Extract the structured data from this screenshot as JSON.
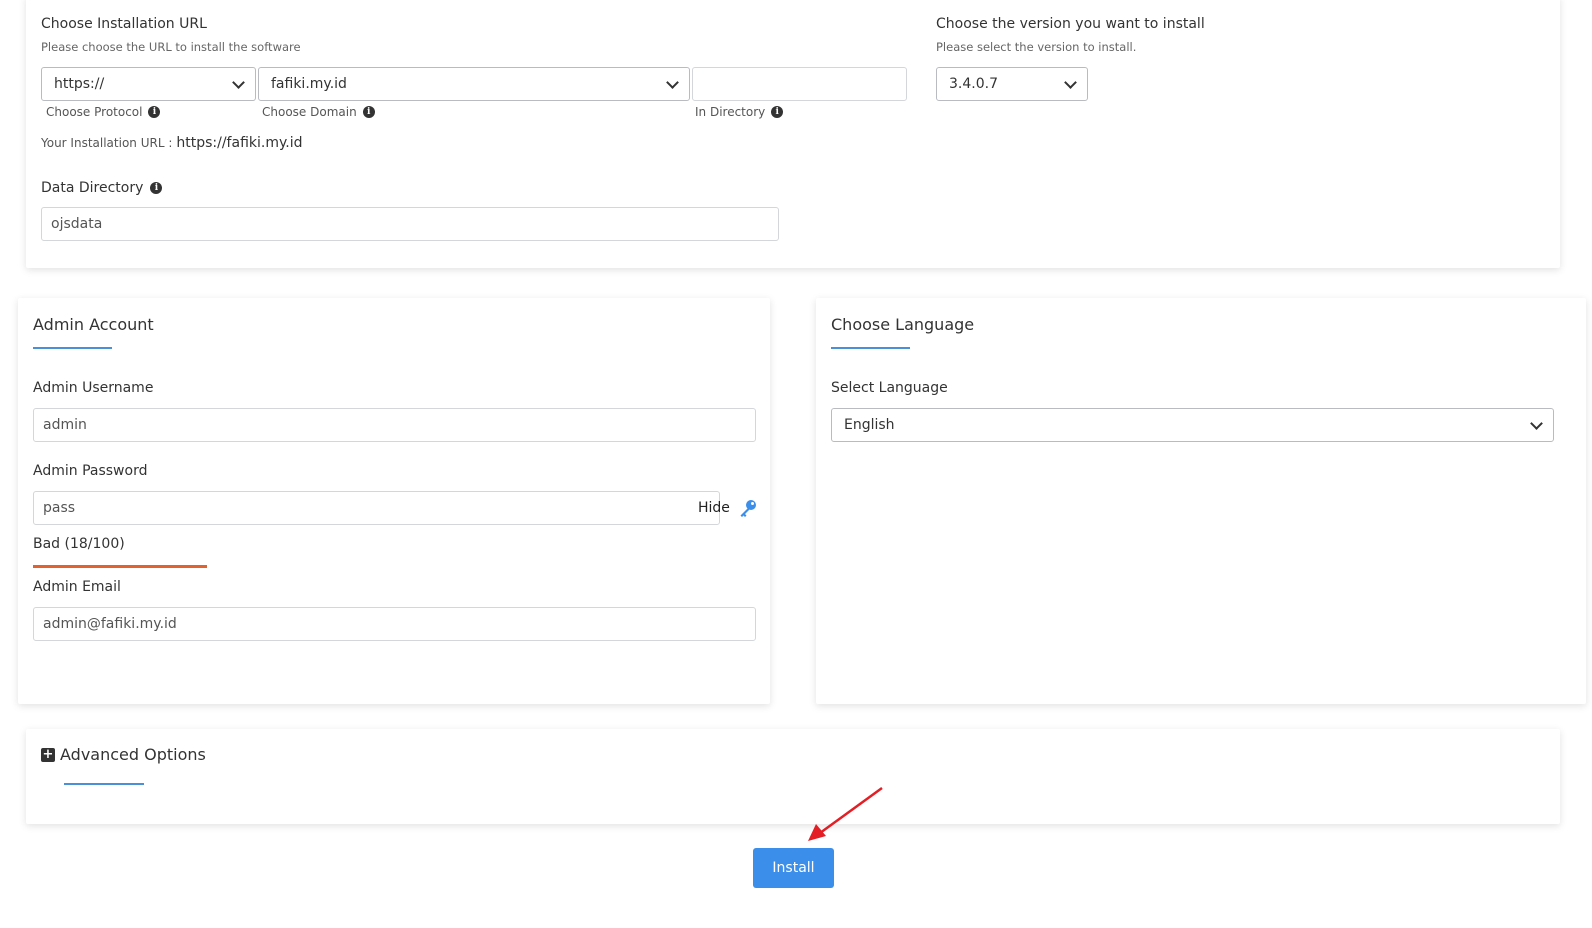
{
  "install_url": {
    "title": "Choose Installation URL",
    "subtitle": "Please choose the URL to install the software",
    "protocol_value": "https://",
    "protocol_label": "Choose Protocol",
    "domain_value": "fafiki.my.id",
    "domain_label": "Choose Domain",
    "directory_value": "",
    "directory_label": "In Directory",
    "your_url_label": "Your Installation URL :",
    "your_url_value": "https://fafiki.my.id",
    "data_dir_label": "Data Directory",
    "data_dir_value": "ojsdata"
  },
  "version": {
    "title": "Choose the version you want to install",
    "subtitle": "Please select the version to install.",
    "value": "3.4.0.7"
  },
  "admin": {
    "title": "Admin Account",
    "username_label": "Admin Username",
    "username_value": "admin",
    "password_label": "Admin Password",
    "password_value": "pass",
    "hide_label": "Hide",
    "strength_text": "Bad (18/100)",
    "strength_score": 0.18,
    "email_label": "Admin Email",
    "email_value": "admin@fafiki.my.id"
  },
  "language": {
    "title": "Choose Language",
    "select_label": "Select Language",
    "value": "English"
  },
  "advanced": {
    "icon": "plus-square-icon",
    "title": "Advanced Options"
  },
  "install_button": "Install",
  "colors": {
    "accent": "#3b8eea",
    "underline": "#4a90d9",
    "strength_bad": "#e2622f",
    "arrow": "#e31e24"
  }
}
